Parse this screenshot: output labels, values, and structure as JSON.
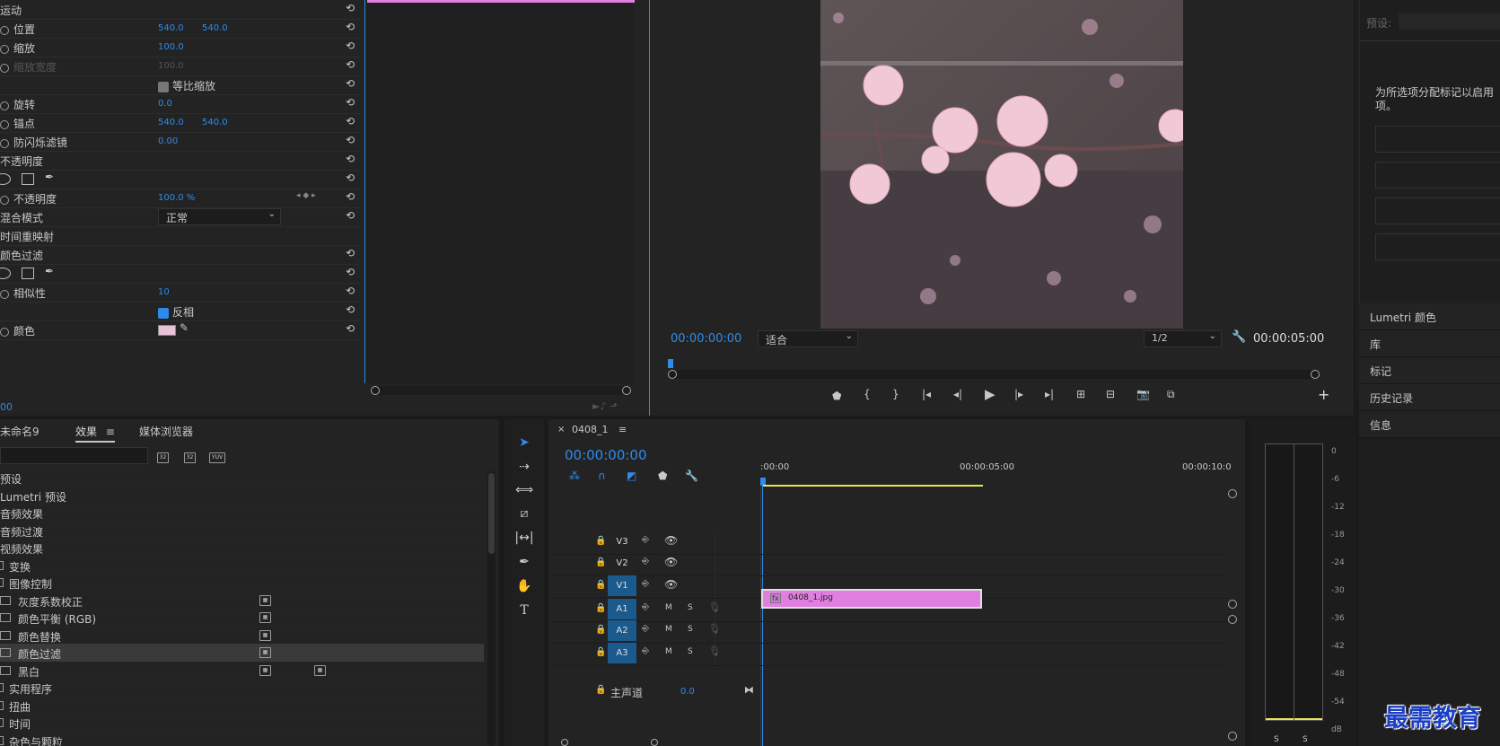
{
  "effect_controls": {
    "rows": [
      {
        "label": "运动",
        "toggle": false
      },
      {
        "label": "位置",
        "toggle": true,
        "v1": "540.0",
        "v2": "540.0"
      },
      {
        "label": "缩放",
        "toggle": true,
        "v1": "100.0"
      },
      {
        "label": "缩放宽度",
        "toggle": true,
        "v1": "100.0",
        "dim": true
      },
      {
        "label": "",
        "checkbox": "等比缩放"
      },
      {
        "label": "旋转",
        "toggle": true,
        "v1": "0.0"
      },
      {
        "label": "锚点",
        "toggle": true,
        "v1": "540.0",
        "v2": "540.0"
      },
      {
        "label": "防闪烁滤镜",
        "toggle": true,
        "v1": "0.00"
      },
      {
        "label": "不透明度",
        "toggle": false
      },
      {
        "label": "",
        "shapes": true
      },
      {
        "label": "不透明度",
        "toggle": true,
        "v1": "100.0 %"
      },
      {
        "label": "混合模式",
        "select": "正常"
      },
      {
        "label": "时间重映射",
        "toggle": false,
        "noreset": true
      },
      {
        "label": "颜色过滤",
        "toggle": false
      },
      {
        "label": "",
        "shapes": true
      },
      {
        "label": "相似性",
        "toggle": true,
        "v1": "10"
      },
      {
        "label": "",
        "checkbox": "反相",
        "checked": true
      },
      {
        "label": "颜色",
        "toggle": true,
        "swatch": true
      }
    ],
    "timecode": "00"
  },
  "program_monitor": {
    "timecode": "00:00:00:00",
    "fit": "适合",
    "resolution": "1/2",
    "duration": "00:00:05:00"
  },
  "right_panel": {
    "preset_label": "预设:",
    "markers_hint": "为所选项分配标记以启用项。",
    "items": [
      "Lumetri 颜色",
      "库",
      "标记",
      "历史记录",
      "信息"
    ]
  },
  "effects_panel": {
    "tabs": [
      "未命名9",
      "效果",
      "媒体浏览器"
    ],
    "rows": [
      {
        "label": "预设",
        "indent": 0
      },
      {
        "label": "Lumetri 预设",
        "indent": 0
      },
      {
        "label": "音频效果",
        "indent": 0
      },
      {
        "label": "音频过渡",
        "indent": 0
      },
      {
        "label": "视频效果",
        "indent": 0
      },
      {
        "label": "变换",
        "indent": 1
      },
      {
        "label": "图像控制",
        "indent": 1
      },
      {
        "label": "灰度系数校正",
        "indent": 2,
        "badge": true
      },
      {
        "label": "颜色平衡 (RGB)",
        "indent": 2,
        "badge": true
      },
      {
        "label": "颜色替换",
        "indent": 2,
        "badge": true
      },
      {
        "label": "颜色过滤",
        "indent": 2,
        "badge": true,
        "selected": true
      },
      {
        "label": "黑白",
        "indent": 2,
        "badge": true,
        "badge2": true
      },
      {
        "label": "实用程序",
        "indent": 1
      },
      {
        "label": "扭曲",
        "indent": 1
      },
      {
        "label": "时间",
        "indent": 1
      },
      {
        "label": "杂色与颗粒",
        "indent": 1
      }
    ],
    "filter_badges": [
      "32",
      "32",
      "YUV"
    ]
  },
  "timeline": {
    "sequence": "0408_1",
    "timecode": "00:00:00:00",
    "ruler": [
      ":00:00",
      "00:00:05:00",
      "00:00:10:0"
    ],
    "tracks": [
      {
        "name": "V3",
        "type": "video"
      },
      {
        "name": "V2",
        "type": "video"
      },
      {
        "name": "V1",
        "type": "video",
        "selected": true
      },
      {
        "name": "A1",
        "type": "audio",
        "selected": true
      },
      {
        "name": "A2",
        "type": "audio",
        "selected": true
      },
      {
        "name": "A3",
        "type": "audio",
        "selected": true
      }
    ],
    "master_label": "主声道",
    "master_value": "0.0",
    "clip": "0408_1.jpg",
    "fx": "fx",
    "m": "M",
    "s": "S"
  },
  "audio_meter": {
    "ticks": [
      "0",
      "-6",
      "-12",
      "-18",
      "-24",
      "-30",
      "-36",
      "-42",
      "-48",
      "-54",
      "dB"
    ],
    "solo": [
      "S",
      "S"
    ]
  },
  "watermark": "最需教育",
  "colors": {
    "accent": "#2d8ceb",
    "clip": "#e07fe0",
    "yellow": "#e8e35a",
    "selected_track": "#1b5a8c"
  }
}
